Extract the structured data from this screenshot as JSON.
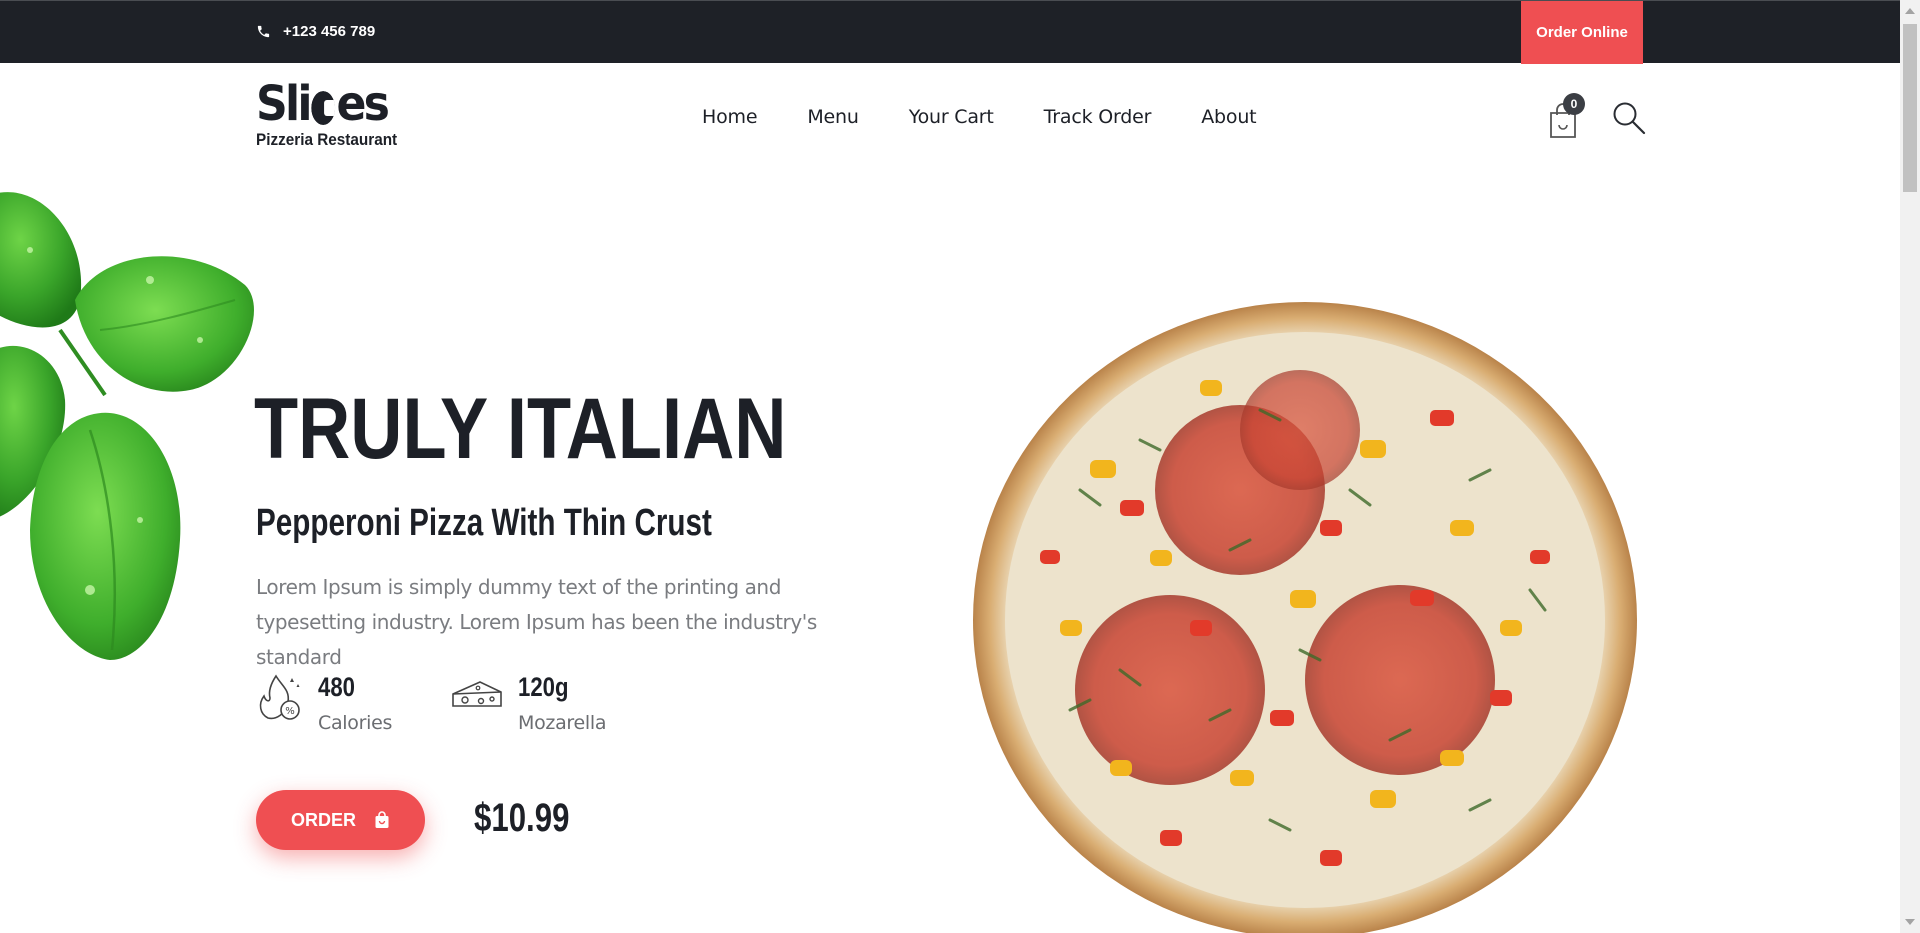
{
  "topbar": {
    "phone_icon": "phone-icon",
    "phone": "+123 456 789",
    "order_online": "Order Online"
  },
  "logo": {
    "word_start": "Sli",
    "word_end": "es",
    "subtitle": "Pizzeria Restaurant"
  },
  "nav": {
    "items": [
      {
        "label": "Home"
      },
      {
        "label": "Menu"
      },
      {
        "label": "Your Cart"
      },
      {
        "label": "Track Order"
      },
      {
        "label": "About"
      }
    ]
  },
  "cart": {
    "icon": "shopping-bag-icon",
    "count": "0"
  },
  "search": {
    "icon": "search-icon"
  },
  "hero": {
    "title": "TRULY ITALIAN",
    "subtitle": "Pepperoni Pizza With Thin Crust",
    "description": "Lorem Ipsum is simply dummy text of the printing and typesetting industry. Lorem Ipsum has been the industry's standard",
    "stats": [
      {
        "icon": "calories-icon",
        "value": "480",
        "label": "Calories"
      },
      {
        "icon": "cheese-icon",
        "value": "120g",
        "label": "Mozarella"
      }
    ],
    "order_label": "ORDER",
    "order_icon": "shopping-bag-icon",
    "price": "$10.99"
  },
  "colors": {
    "accent": "#ef4f52",
    "dark": "#1e2127",
    "text_muted": "#7a7c80"
  }
}
